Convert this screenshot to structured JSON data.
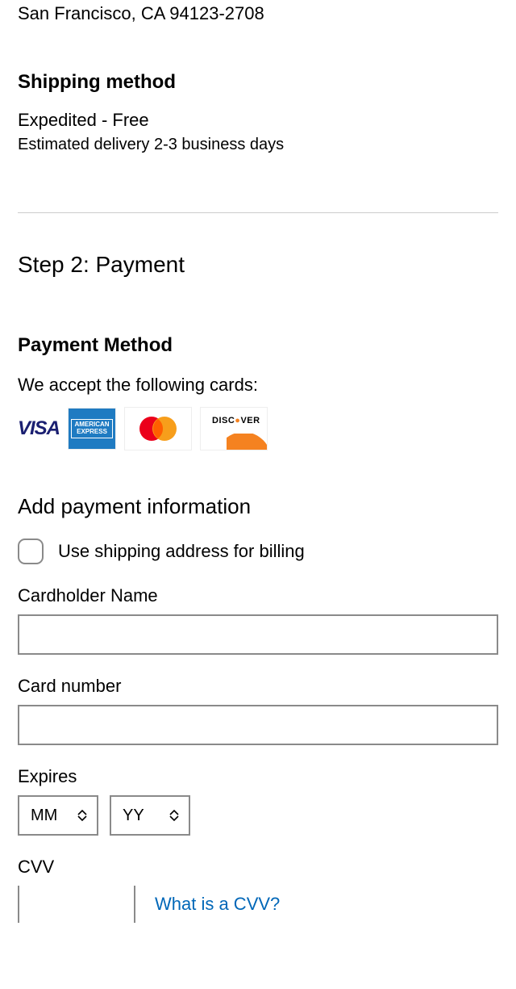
{
  "address": {
    "line2": "San Francisco, CA 94123-2708"
  },
  "shipping": {
    "heading": "Shipping method",
    "option": "Expedited - Free",
    "estimate": "Estimated delivery 2-3 business days"
  },
  "step": {
    "title": "Step 2: Payment"
  },
  "payment_method": {
    "heading": "Payment Method",
    "accept_text": "We accept the following cards:",
    "cards": {
      "visa": "VISA",
      "amex_line1": "AMERICAN",
      "amex_line2": "EXPRESS",
      "discover": "DISC   VER"
    }
  },
  "payment_info": {
    "heading": "Add payment information",
    "use_shipping_label": "Use shipping address for billing",
    "use_shipping_checked": false,
    "cardholder_label": "Cardholder Name",
    "cardholder_value": "",
    "cardnumber_label": "Card number",
    "cardnumber_value": "",
    "expires_label": "Expires",
    "expires_month_placeholder": "MM",
    "expires_year_placeholder": "YY",
    "cvv_label": "CVV",
    "cvv_value": "",
    "cvv_link": "What is a CVV?"
  }
}
